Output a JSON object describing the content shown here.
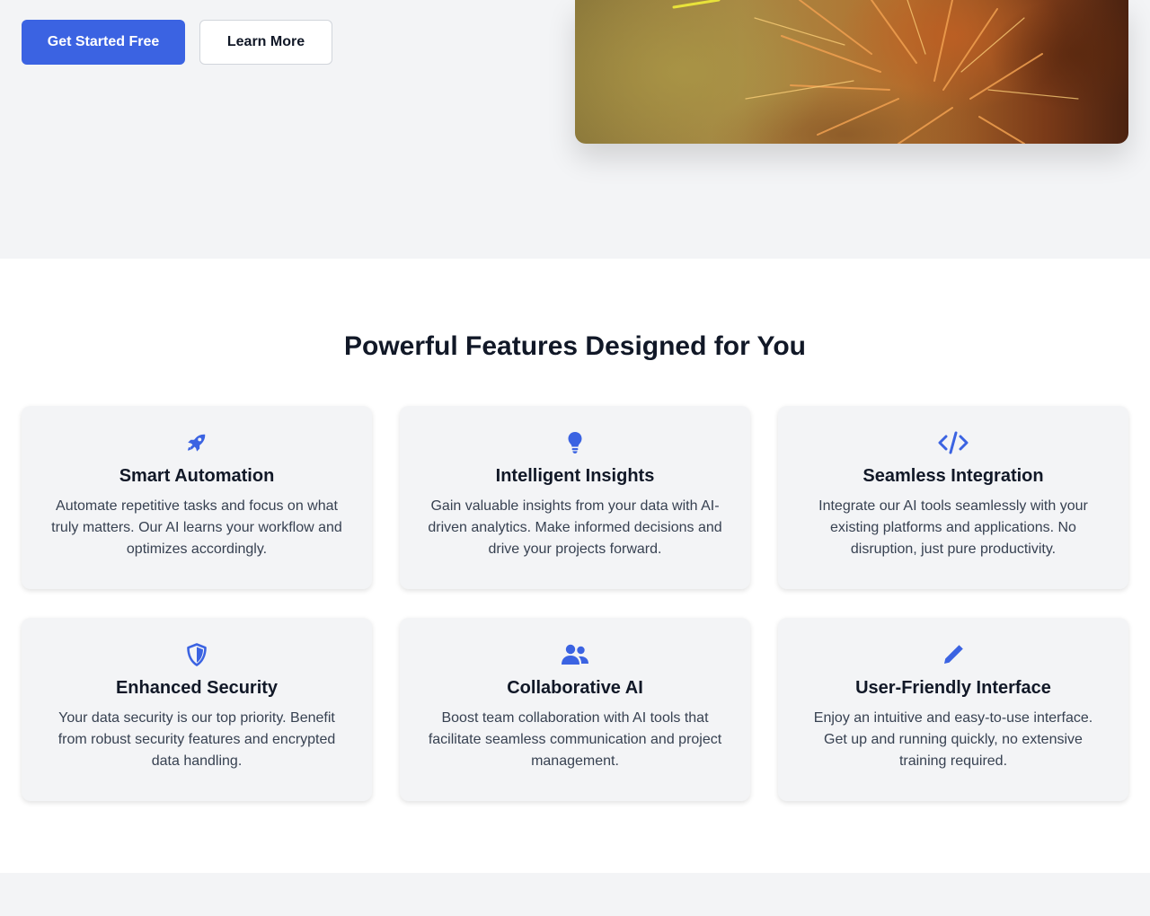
{
  "hero": {
    "primary_button": "Get Started Free",
    "secondary_button": "Learn More",
    "accent_color": "#3b63e2"
  },
  "features": {
    "title": "Powerful Features Designed for You",
    "cards": [
      {
        "icon": "rocket-icon",
        "title": "Smart Automation",
        "description": "Automate repetitive tasks and focus on what truly matters. Our AI learns your workflow and optimizes accordingly."
      },
      {
        "icon": "lightbulb-icon",
        "title": "Intelligent Insights",
        "description": "Gain valuable insights from your data with AI-driven analytics. Make informed decisions and drive your projects forward."
      },
      {
        "icon": "code-icon",
        "title": "Seamless Integration",
        "description": "Integrate our AI tools seamlessly with your existing platforms and applications. No disruption, just pure productivity."
      },
      {
        "icon": "shield-icon",
        "title": "Enhanced Security",
        "description": "Your data security is our top priority. Benefit from robust security features and encrypted data handling."
      },
      {
        "icon": "users-icon",
        "title": "Collaborative AI",
        "description": "Boost team collaboration with AI tools that facilitate seamless communication and project management."
      },
      {
        "icon": "pen-icon",
        "title": "User-Friendly Interface",
        "description": "Enjoy an intuitive and easy-to-use interface. Get up and running quickly, no extensive training required."
      }
    ]
  }
}
